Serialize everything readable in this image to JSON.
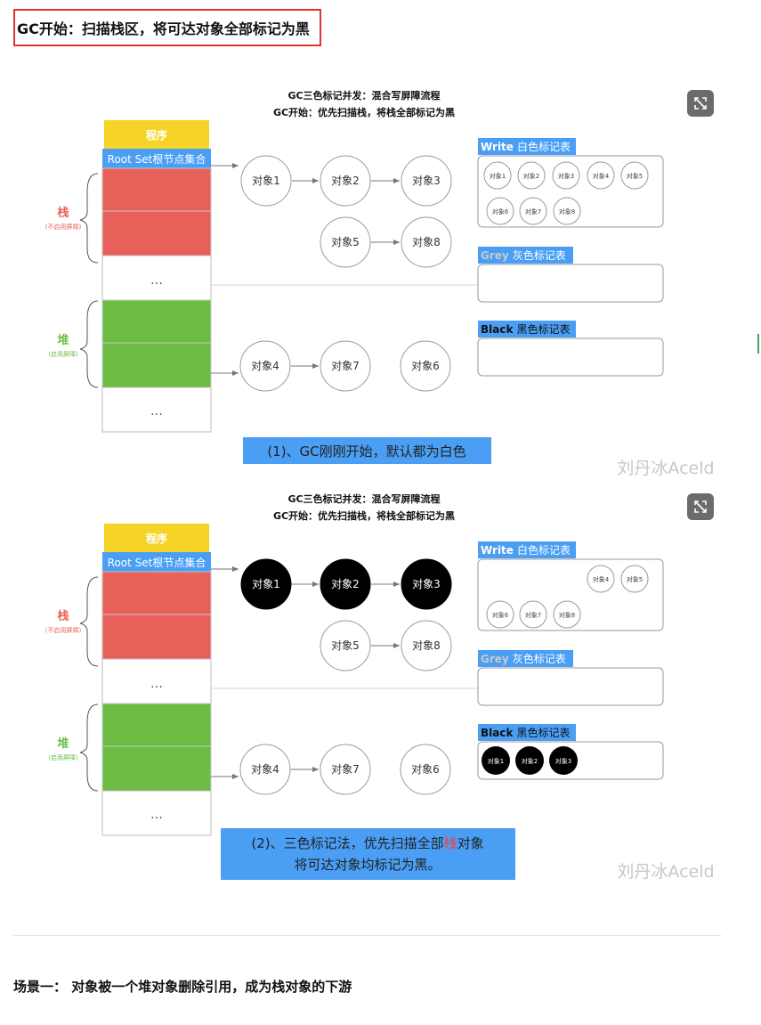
{
  "heading": "GC开始：扫描栈区，将可达对象全部标记为黑",
  "figures": [
    {
      "title_line1": "GC三色标记并发：混合写屏障流程",
      "title_line2": "GC开始：优先扫描栈，将栈全部标记为黑",
      "program_label": "程序",
      "rootset_label": "Root Set根节点集合",
      "stack_label": "栈",
      "stack_note": "(不启用屏障)",
      "heap_label": "堆",
      "heap_note": "(启用屏障)",
      "ellipsis": "…",
      "nodes": {
        "o1": {
          "label": "对象1",
          "color": "white"
        },
        "o2": {
          "label": "对象2",
          "color": "white"
        },
        "o3": {
          "label": "对象3",
          "color": "white"
        },
        "o5": {
          "label": "对象5",
          "color": "white"
        },
        "o8": {
          "label": "对象8",
          "color": "white"
        },
        "o4": {
          "label": "对象4",
          "color": "white"
        },
        "o7": {
          "label": "对象7",
          "color": "white"
        },
        "o6": {
          "label": "对象6",
          "color": "white"
        }
      },
      "white_table": {
        "label_en": "Write",
        "label_cn": "白色标记表",
        "items": [
          "对象1",
          "对象2",
          "对象3",
          "对象4",
          "对象5",
          "对象6",
          "对象7",
          "对象8"
        ]
      },
      "grey_table": {
        "label_en": "Grey",
        "label_cn": "灰色标记表",
        "items": []
      },
      "black_table": {
        "label_en": "Black",
        "label_cn": "黑色标记表",
        "items": []
      },
      "caption_lines": [
        "(1)、GC刚刚开始，默认都为白色"
      ],
      "watermark": "刘丹冰Aceld"
    },
    {
      "title_line1": "GC三色标记并发：混合写屏障流程",
      "title_line2": "GC开始：优先扫描栈，将栈全部标记为黑",
      "program_label": "程序",
      "rootset_label": "Root Set根节点集合",
      "stack_label": "栈",
      "stack_note": "(不启用屏障)",
      "heap_label": "堆",
      "heap_note": "(启用屏障)",
      "ellipsis": "…",
      "nodes": {
        "o1": {
          "label": "对象1",
          "color": "black"
        },
        "o2": {
          "label": "对象2",
          "color": "black"
        },
        "o3": {
          "label": "对象3",
          "color": "black"
        },
        "o5": {
          "label": "对象5",
          "color": "white"
        },
        "o8": {
          "label": "对象8",
          "color": "white"
        },
        "o4": {
          "label": "对象4",
          "color": "white"
        },
        "o7": {
          "label": "对象7",
          "color": "white"
        },
        "o6": {
          "label": "对象6",
          "color": "white"
        }
      },
      "white_table": {
        "label_en": "Write",
        "label_cn": "白色标记表",
        "items": [
          "对象4",
          "对象5",
          "对象6",
          "对象7",
          "对象8"
        ]
      },
      "grey_table": {
        "label_en": "Grey",
        "label_cn": "灰色标记表",
        "items": []
      },
      "black_table": {
        "label_en": "Black",
        "label_cn": "黑色标记表",
        "items": [
          "对象1",
          "对象2",
          "对象3"
        ]
      },
      "caption_lines": [
        "(2)、三色标记法，优先扫描全部栈对象",
        "将可达对象均标记为黑。"
      ],
      "caption_highlight": "栈",
      "watermark": "刘丹冰Aceld"
    }
  ],
  "scene_title": "场景一： 对象被一个堆对象删除引用，成为栈对象的下游",
  "colors": {
    "program": "#f5d327",
    "rootset": "#4a9ff5",
    "stack": "#e8605a",
    "heap": "#6dbd45",
    "stack_text": "#e8605a",
    "heap_text": "#6dbd45",
    "grey_label_text": "#c9c9c9",
    "caption_bg": "#4a9ff5",
    "highlight_red": "#ff3b30",
    "heading_border": "#e03232"
  }
}
